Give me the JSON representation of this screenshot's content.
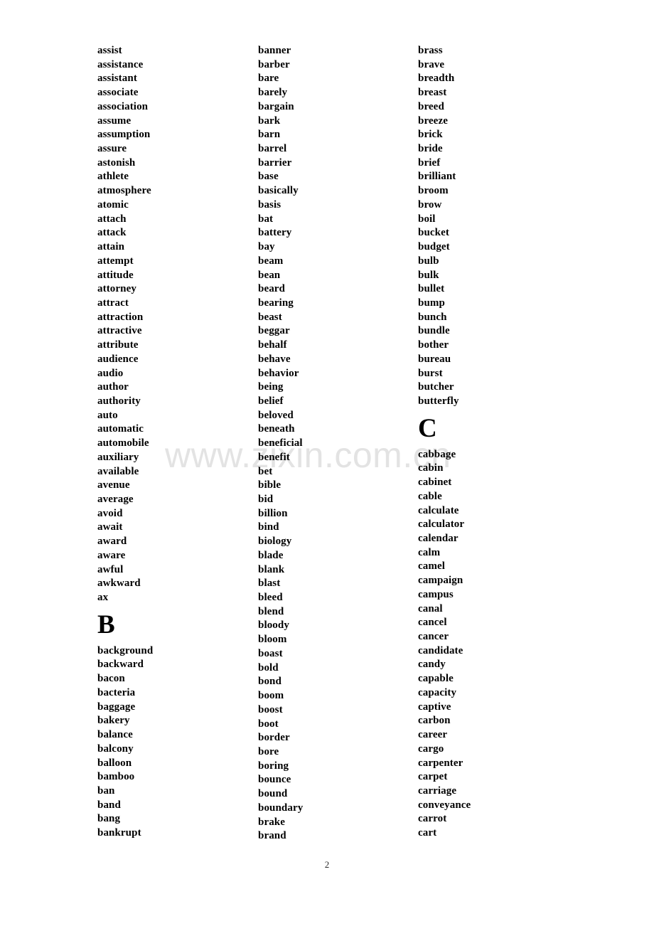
{
  "document": {
    "page_number": "2",
    "watermark": "www.zixin.com.cn"
  },
  "columns": [
    {
      "id": "column-1",
      "blocks": [
        {
          "type": "words",
          "items": [
            "assist",
            "assistance",
            "assistant",
            "associate",
            "association",
            "assume",
            "assumption",
            "assure",
            "astonish",
            "athlete",
            "atmosphere",
            "atomic",
            "attach",
            "attack",
            "attain",
            "attempt",
            "attitude",
            "attorney",
            "attract",
            "attraction",
            "attractive",
            "attribute",
            "audience",
            "audio",
            "author",
            "authority",
            "auto",
            "automatic",
            "automobile",
            "auxiliary",
            "available",
            "avenue",
            "average",
            "avoid",
            "await",
            "award",
            "aware",
            "awful",
            "awkward",
            "ax"
          ]
        },
        {
          "type": "letter",
          "letter": "B"
        },
        {
          "type": "words",
          "items": [
            "background",
            "backward",
            "bacon",
            "bacteria",
            "baggage",
            "bakery",
            "balance",
            "balcony",
            "balloon",
            "bamboo",
            "ban",
            "band",
            "bang",
            "bankrupt"
          ]
        }
      ]
    },
    {
      "id": "column-2",
      "blocks": [
        {
          "type": "words",
          "items": [
            "banner",
            "barber",
            "bare",
            "barely",
            "bargain",
            "bark",
            "barn",
            "barrel",
            "barrier",
            "base",
            "basically",
            "basis",
            "bat",
            "battery",
            "bay",
            "beam",
            "bean",
            "beard",
            "bearing",
            "beast",
            "beggar",
            "behalf",
            "behave",
            "behavior",
            "being",
            "belief",
            "beloved",
            "beneath",
            "beneficial",
            "benefit",
            "bet",
            "bible",
            "bid",
            "billion",
            "bind",
            "biology",
            "blade",
            "blank",
            "blast",
            "bleed",
            "blend",
            "bloody",
            "bloom",
            "boast",
            "bold",
            "bond",
            "boom",
            "boost",
            "boot",
            "border",
            "bore",
            "boring",
            "bounce",
            "bound",
            "boundary",
            "brake",
            "brand"
          ]
        }
      ]
    },
    {
      "id": "column-3",
      "blocks": [
        {
          "type": "words",
          "items": [
            "brass",
            "brave",
            "breadth",
            "breast",
            "breed",
            "breeze",
            "brick",
            "bride",
            "brief",
            "brilliant",
            "broom",
            "brow",
            "boil",
            "bucket",
            "budget",
            "bulb",
            "bulk",
            "bullet",
            "bump",
            "bunch",
            "bundle",
            "bother",
            "bureau",
            "burst",
            "butcher",
            "butterfly"
          ]
        },
        {
          "type": "letter",
          "letter": "C"
        },
        {
          "type": "words",
          "items": [
            "cabbage",
            "cabin",
            "cabinet",
            "cable",
            "calculate",
            "calculator",
            "calendar",
            "calm",
            "camel",
            "campaign",
            "campus",
            "canal",
            "cancel",
            "cancer",
            "candidate",
            "candy",
            "capable",
            "capacity",
            "captive",
            "carbon",
            "career",
            "cargo",
            "carpenter",
            "carpet",
            "carriage",
            "conveyance",
            "carrot",
            "cart"
          ]
        }
      ]
    }
  ]
}
